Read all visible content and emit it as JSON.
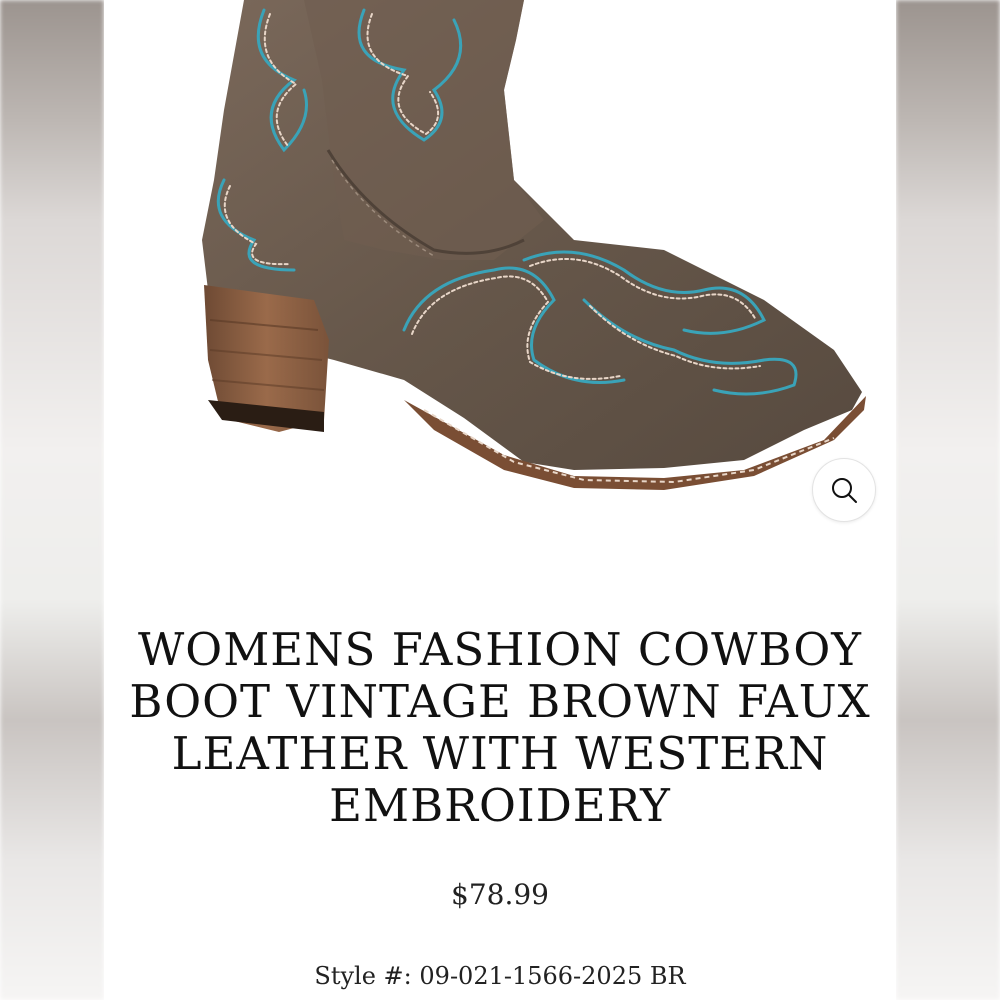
{
  "product": {
    "title": "WOMENS FASHION COWBOY BOOT VINTAGE BROWN FAUX LEATHER WITH WESTERN EMBROIDERY",
    "price": "$78.99",
    "style_label": "Style #:",
    "style_number": "09-021-1566-2025 BR"
  },
  "image": {
    "subject": "brown-cowboy-boot",
    "leather_color": "#6b5a4c",
    "stitch_primary": "#3aa3b8",
    "stitch_secondary": "#e8d6c8",
    "heel_color": "#8a5a3c"
  },
  "icons": {
    "zoom": "magnifier-icon"
  }
}
